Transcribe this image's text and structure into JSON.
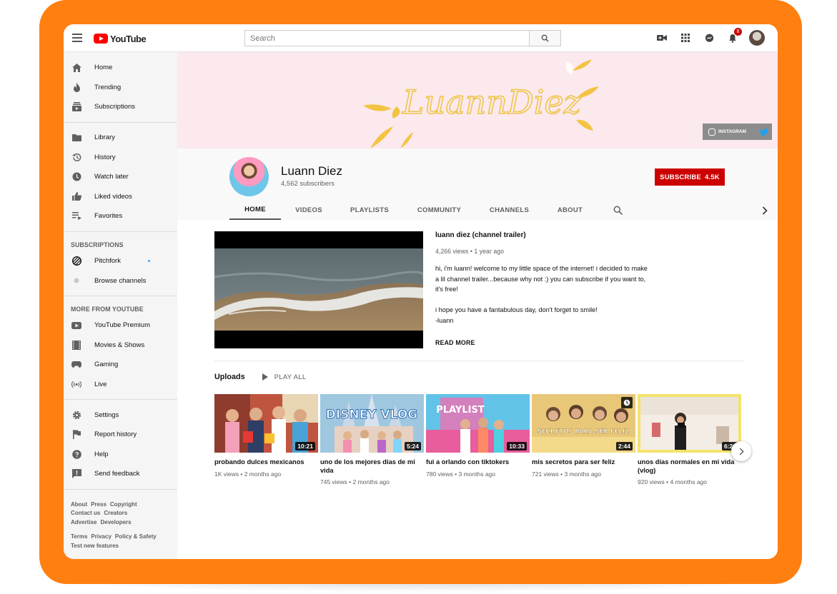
{
  "app": {
    "logo_text": "YouTube"
  },
  "search": {
    "placeholder": "Search"
  },
  "topbar": {
    "notification_count": "8"
  },
  "sidebar": {
    "main": [
      {
        "label": "Home",
        "icon": "home-icon"
      },
      {
        "label": "Trending",
        "icon": "flame-icon"
      },
      {
        "label": "Subscriptions",
        "icon": "subscriptions-icon"
      }
    ],
    "library": [
      {
        "label": "Library",
        "icon": "folder-icon"
      },
      {
        "label": "History",
        "icon": "history-icon"
      },
      {
        "label": "Watch later",
        "icon": "clock-icon"
      },
      {
        "label": "Liked videos",
        "icon": "thumbs-up-icon"
      },
      {
        "label": "Favorites",
        "icon": "playlist-icon"
      }
    ],
    "subscriptions_heading": "SUBSCRIPTIONS",
    "subscriptions": [
      {
        "label": "Pitchfork",
        "icon": "pitchfork-icon"
      },
      {
        "label": "Browse channels",
        "icon": "plus-circle-icon"
      }
    ],
    "more_heading": "MORE FROM YOUTUBE",
    "more": [
      {
        "label": "YouTube Premium",
        "icon": "youtube-icon"
      },
      {
        "label": "Movies & Shows",
        "icon": "film-icon"
      },
      {
        "label": "Gaming",
        "icon": "gamepad-icon"
      },
      {
        "label": "Live",
        "icon": "live-icon"
      }
    ],
    "settings": [
      {
        "label": "Settings",
        "icon": "gear-icon"
      },
      {
        "label": "Report history",
        "icon": "flag-icon"
      },
      {
        "label": "Help",
        "icon": "help-icon"
      },
      {
        "label": "Send feedback",
        "icon": "feedback-icon"
      }
    ],
    "footer": {
      "row1": [
        "About",
        "Press",
        "Copyright"
      ],
      "row2": [
        "Contact us",
        "Creators"
      ],
      "row3": [
        "Advertise",
        "Developers"
      ],
      "row4": [
        "Terms",
        "Privacy",
        "Policy & Safety"
      ],
      "row5": [
        "Test new features"
      ]
    }
  },
  "banner": {
    "script_text": "LuannDiez",
    "links_label": "INSTAGRAM"
  },
  "channel": {
    "name": "Luann Diez",
    "subscribers": "4,562 subscribers",
    "subscribe_label": "SUBSCRIBE",
    "subscribe_count": "4.5K",
    "tabs": [
      "HOME",
      "VIDEOS",
      "PLAYLISTS",
      "COMMUNITY",
      "CHANNELS",
      "ABOUT"
    ]
  },
  "trailer": {
    "title": "luann diez (channel trailer)",
    "meta": "4,266 views • 1 year ago",
    "description": [
      "hi, i'm luann! welcome to my little space of the internet! i decided to make a lil channel trailer...because why not :) you can subscribe if you want to, it's free!",
      "",
      "i hope you have a fantabulous day, don't forget to smile!",
      "-luann"
    ],
    "read_more": "READ MORE"
  },
  "uploads": {
    "title": "Uploads",
    "play_all": "PLAY ALL",
    "videos": [
      {
        "title": "probando dulces mexicanos",
        "meta": "1K views • 2 months ago",
        "duration": "10:21",
        "overlay": ""
      },
      {
        "title": "uno de los mejores dias de mi vida",
        "meta": "745 views • 2 months ago",
        "duration": "5:24",
        "overlay": "DISNEY VLOG"
      },
      {
        "title": "fui a orlando con tiktokers",
        "meta": "780 views • 3 months ago",
        "duration": "10:33",
        "overlay": "PLAYLIST"
      },
      {
        "title": "mis secretos para ser feliz",
        "meta": "721 views • 3 months ago",
        "duration": "2:44",
        "overlay": "SECRETOS PARA SER FELIZ"
      },
      {
        "title": "unos dias normales en mi vida (vlog)",
        "meta": "920 views • 4 months ago",
        "duration": "6:22",
        "overlay": ""
      }
    ]
  },
  "colors": {
    "frame": "#FF7F11",
    "brand_red": "#FF0000",
    "subscribe_red": "#CC0000",
    "banner_bg": "#FBE9EE",
    "banner_gold": "#F3C443"
  }
}
